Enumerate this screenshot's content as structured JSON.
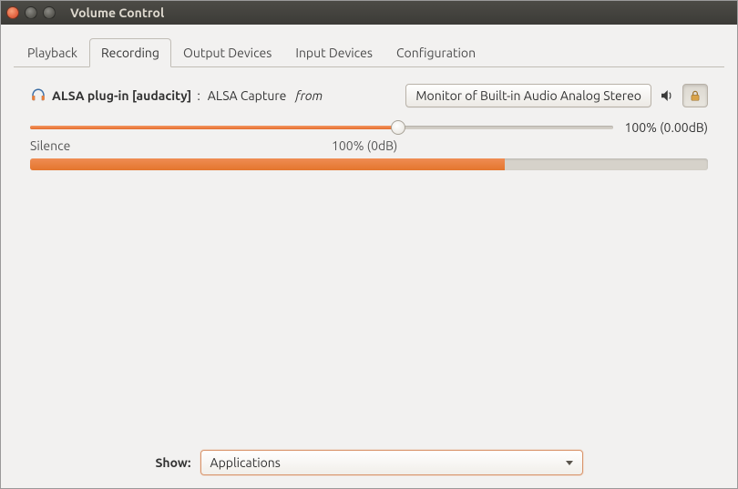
{
  "window": {
    "title": "Volume Control"
  },
  "tabs": [
    {
      "label": "Playback"
    },
    {
      "label": "Recording"
    },
    {
      "label": "Output Devices"
    },
    {
      "label": "Input Devices"
    },
    {
      "label": "Configuration"
    }
  ],
  "active_tab_index": 1,
  "stream": {
    "app_name": "ALSA plug-in [audacity]",
    "stream_name": "ALSA Capture",
    "from_label": "from",
    "device": "Monitor of Built-in Audio Analog Stereo",
    "volume_percent": 63,
    "volume_text": "100% (0.00dB)",
    "label_silence": "Silence",
    "label_center": "100% (0dB)",
    "meter_percent": 70,
    "muted": false,
    "locked": true
  },
  "footer": {
    "show_label": "Show:",
    "show_value": "Applications"
  }
}
